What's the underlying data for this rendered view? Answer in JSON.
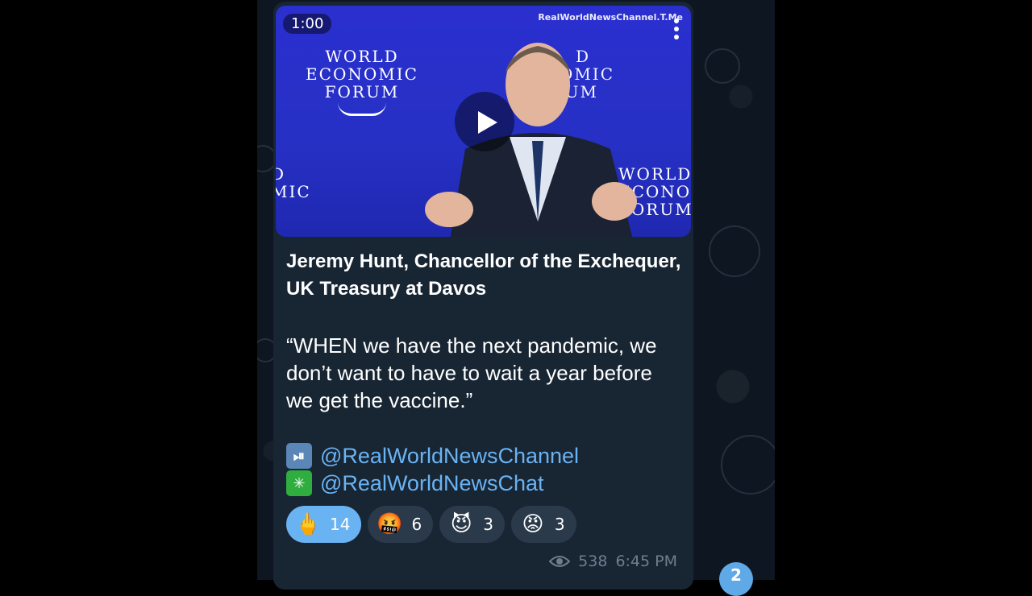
{
  "video": {
    "duration": "1:00",
    "watermark": "RealWorldNewsChannel.T.Me",
    "logo_lines": [
      "WORLD",
      "ECONOMIC",
      "FORUM"
    ],
    "logo_right_lines": [
      "WORLD",
      "ECONOM",
      "FORUM"
    ],
    "logo_center_lines": [
      "D",
      "OMIC",
      "UM"
    ],
    "logo_left_lines": [
      "D",
      "MIC"
    ]
  },
  "message": {
    "title": "Jeremy Hunt, Chancellor of the Exchequer, UK Treasury at Davos",
    "quote": "“WHEN we have the next pandemic, we don’t want to have to wait a year before we get the vaccine.”",
    "links": [
      {
        "icon": "play-pause-icon",
        "text": "@RealWorldNewsChannel",
        "color": "#6ab3f3"
      },
      {
        "icon": "asterisk-icon",
        "text": "@RealWorldNewsChat",
        "color": "#6ab3f3"
      }
    ],
    "reactions": [
      {
        "emoji": "🖕",
        "icon": "middle-finger-icon",
        "count": "14",
        "active": true
      },
      {
        "emoji": "🤬",
        "icon": "cursing-face-icon",
        "count": "6",
        "active": false
      },
      {
        "emoji": "😈",
        "icon": "smiling-devil-icon",
        "count": "3",
        "active": false
      },
      {
        "emoji": "😡",
        "icon": "angry-face-icon",
        "count": "3",
        "active": false
      }
    ],
    "views": "538",
    "time": "6:45 PM"
  },
  "unread_count": "2",
  "colors": {
    "chat_background": "#0e1621",
    "bubble": "#182533",
    "link": "#6ab3f3",
    "active_reaction": "#6ab3f3",
    "video_background": "#2a2fcf"
  }
}
